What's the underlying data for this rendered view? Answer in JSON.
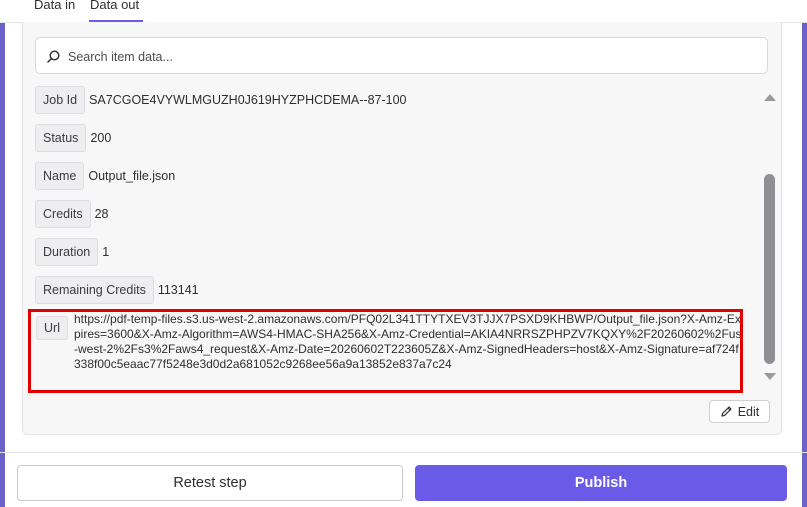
{
  "tabs": {
    "data_in": "Data in",
    "data_out": "Data out"
  },
  "search": {
    "placeholder": "Search item data..."
  },
  "fields": {
    "job_id": {
      "key": "Job Id",
      "value": "SA7CGOE4VYWLMGUZH0J619HYZPHCDEMA--87-100"
    },
    "status": {
      "key": "Status",
      "value": "200"
    },
    "name": {
      "key": "Name",
      "value": "Output_file.json"
    },
    "credits": {
      "key": "Credits",
      "value": "28"
    },
    "duration": {
      "key": "Duration",
      "value": "1"
    },
    "remaining_credits": {
      "key": "Remaining Credits",
      "value": "113141"
    },
    "url": {
      "key": "Url",
      "value": "https://pdf-temp-files.s3.us-west-2.amazonaws.com/PFQ02L341TTYTXEV3TJJX7PSXD9KHBWP/Output_file.json?X-Amz-Expires=3600&X-Amz-Algorithm=AWS4-HMAC-SHA256&X-Amz-Credential=AKIA4NRRSZPHPZV7KQXY%2F20260602%2Fus-west-2%2Fs3%2Faws4_request&X-Amz-Date=20260602T223605Z&X-Amz-SignedHeaders=host&X-Amz-Signature=af724f338f00c5eaac77f5248e3d0d2a681052c9268ee56a9a13852e837a7c24"
    }
  },
  "actions": {
    "edit": "Edit",
    "retest": "Retest step",
    "publish": "Publish"
  },
  "colors": {
    "accent": "#695be8",
    "highlight": "#e00000",
    "frame": "#6b61c9"
  }
}
